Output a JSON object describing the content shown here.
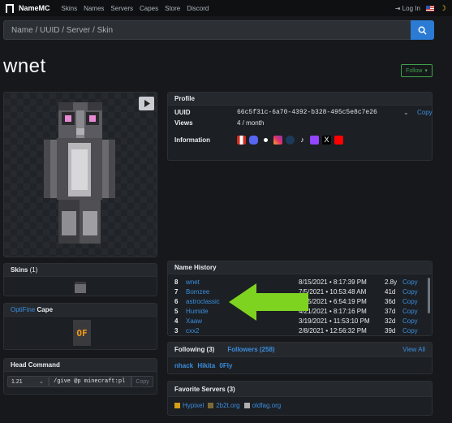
{
  "nav": {
    "brand": "NameMC",
    "links": [
      "Skins",
      "Names",
      "Servers",
      "Capes",
      "Store",
      "Discord"
    ],
    "login": "Log In"
  },
  "search": {
    "placeholder": "Name / UUID / Server / Skin"
  },
  "profile_name": "wnet",
  "follow_label": "Follow",
  "profile": {
    "header": "Profile",
    "uuid_label": "UUID",
    "uuid_value": "66c5f31c-6a70-4392-b328-495c5e8c7e26",
    "copy_label": "Copy",
    "views_label": "Views",
    "views_value": "4 / month",
    "information_label": "Information",
    "social_icons": [
      "canada-flag-icon",
      "discord-icon",
      "github-icon",
      "instagram-icon",
      "steam-icon",
      "tiktok-icon",
      "twitch-icon",
      "x-icon",
      "youtube-icon"
    ]
  },
  "skins": {
    "header": "Skins",
    "count": "(1)"
  },
  "cape": {
    "header_link": "OptiFine",
    "header_rest": "Cape",
    "badge": "OF"
  },
  "head_command": {
    "header": "Head Command",
    "version": "1.21",
    "command": "/give @p minecraft:pl",
    "copy_label": "Copy"
  },
  "name_history": {
    "header": "Name History",
    "rows": [
      {
        "num": "8",
        "name": "wnet",
        "date": "8/15/2021 • 8:17:39 PM",
        "ago": "2.8y",
        "copy": "Copy"
      },
      {
        "num": "7",
        "name": "Bomzee",
        "date": "7/5/2021 • 10:53:48 AM",
        "ago": "41d",
        "copy": "Copy"
      },
      {
        "num": "6",
        "name": "astroclassic",
        "date": "5/25/2021 • 6:54:19 PM",
        "ago": "36d",
        "copy": "Copy"
      },
      {
        "num": "5",
        "name": "Humide",
        "date": "4/21/2021 • 8:17:16 PM",
        "ago": "37d",
        "copy": "Copy"
      },
      {
        "num": "4",
        "name": "Xaaw",
        "date": "3/19/2021 • 11:53:10 PM",
        "ago": "32d",
        "copy": "Copy"
      },
      {
        "num": "3",
        "name": "cxx2",
        "date": "2/8/2021 • 12:56:32 PM",
        "ago": "39d",
        "copy": "Copy"
      }
    ]
  },
  "following": {
    "label": "Following (3)",
    "followers": "Followers (258)",
    "view_all": "View All",
    "names": [
      "nhack",
      "Hikita",
      "0Fly"
    ]
  },
  "servers": {
    "header": "Favorite Servers (3)",
    "items": [
      "Hypixel",
      "2b2t.org",
      "oldfag.org"
    ]
  },
  "colors": {
    "accent": "#2b7bd4",
    "link": "#3b8ede",
    "arrow": "#7ed321",
    "follow": "#3fa04a"
  }
}
